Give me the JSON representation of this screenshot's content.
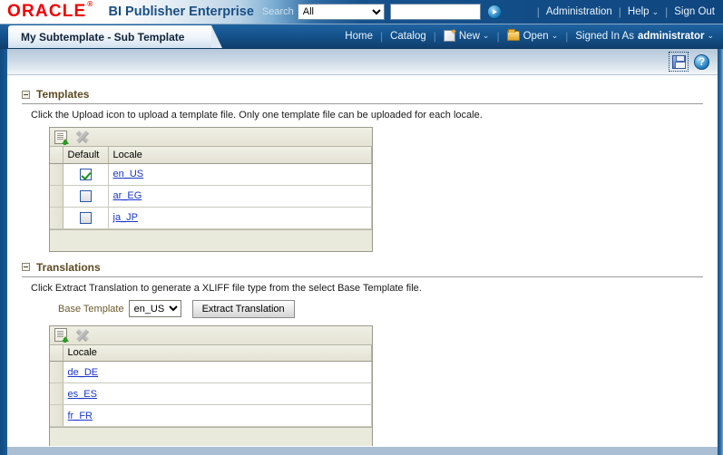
{
  "header": {
    "logo_text": "ORACLE",
    "logo_mark": "®",
    "product_name": "BI Publisher Enterprise",
    "search_label": "Search",
    "search_scope_value": "All",
    "search_scope_options": [
      "All"
    ],
    "search_value": "",
    "search_placeholder": "",
    "go_icon": "go-arrow-icon",
    "links": [
      {
        "label": "Administration",
        "name": "administration-link",
        "caret": false
      },
      {
        "label": "Help",
        "name": "help-link",
        "caret": true
      },
      {
        "label": "Sign Out",
        "name": "sign-out-link",
        "caret": false
      }
    ],
    "caret_glyph": "⌄"
  },
  "navbar": {
    "active_tab": "My Subtemplate - Sub Template",
    "home_label": "Home",
    "catalog_label": "Catalog",
    "new_label": "New",
    "open_label": "Open",
    "signed_in_as_label": "Signed In As",
    "user_name": "administrator",
    "caret_glyph": "⌄"
  },
  "page_toolbar": {
    "save_icon": "save-floppy-icon",
    "help_icon": "help-question-icon",
    "help_glyph": "?"
  },
  "templates_section": {
    "title": "Templates",
    "description": "Click the Upload icon to upload a template file. Only one template file can be uploaded for each locale.",
    "toolbar": {
      "upload_icon": "upload-icon",
      "delete_icon": "delete-icon"
    },
    "columns": [
      "Default",
      "Locale"
    ],
    "rows": [
      {
        "default_checked": true,
        "locale": "en_US"
      },
      {
        "default_checked": false,
        "locale": "ar_EG"
      },
      {
        "default_checked": false,
        "locale": "ja_JP"
      }
    ]
  },
  "translations_section": {
    "title": "Translations",
    "description": "Click Extract Translation to generate a XLIFF file type from the select Base Template file.",
    "base_template_label": "Base Template",
    "base_template_value": "en_US",
    "base_template_options": [
      "en_US"
    ],
    "extract_button_label": "Extract Translation",
    "toolbar": {
      "upload_icon": "upload-icon",
      "delete_icon": "delete-icon"
    },
    "columns": [
      "Locale"
    ],
    "rows": [
      {
        "locale": "de_DE"
      },
      {
        "locale": "es_ES"
      },
      {
        "locale": "fr_FR"
      }
    ]
  },
  "colors": {
    "oracle_red": "#f00000",
    "product_blue": "#1b4f82",
    "nav_blue": "#14528c",
    "link_blue": "#1a37c8",
    "section_title": "#5c4a21",
    "grid_header": "#e9e9dc"
  }
}
